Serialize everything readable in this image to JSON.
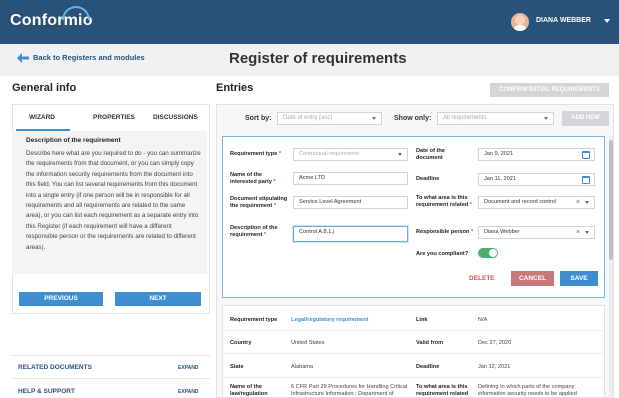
{
  "header": {
    "brand": "Conformio",
    "user_name": "DIANA WEBBER"
  },
  "subheader": {
    "back_link": "Back to Registers and modules",
    "page_title": "Register of requirements"
  },
  "left": {
    "section_title": "General info",
    "tabs": [
      "WIZARD",
      "PROPERTIES",
      "DISCUSSIONS"
    ],
    "active_tab": "WIZARD",
    "desc_title": "Description of the requirement",
    "desc_text": "Describe here what are you required to do - you can summarize the requirements from that document, or you can simply copy the information security requirements from the document into this field. You can list several requirements from this document into a single entry (if one person will be in responsible for all requirements and all requirements are related to the same area), or you can list each requirement as a separate entry into this Register (if each requirement will have a different responsible person or the requirements are related to different areas).",
    "prev_label": "PREVIOUS",
    "next_label": "NEXT",
    "related_docs": "RELATED DOCUMENTS",
    "help_support": "HELP & SUPPORT",
    "expand": "EXPAND"
  },
  "entries": {
    "section_title": "Entries",
    "confirm_label": "CONFIRM INITIAL REQUIREMENTS",
    "sort_by_label": "Sort by:",
    "sort_by_value": "Date of entry (asc)",
    "show_only_label": "Show only:",
    "show_only_value": "All requirements",
    "add_new": "ADD NEW"
  },
  "form": {
    "req_type_label": "Requirement type",
    "req_type_placeholder": "Contractual requirement",
    "party_label": "Name of the interested party",
    "party_value": "Acme LTD",
    "doc_label": "Document stipulating the requirement",
    "doc_value": "Service Level Agreement",
    "desc_label": "Description of the requirement",
    "desc_value": "Control A.8.1.|",
    "entry_date_label": "Date of the document",
    "entry_date_value": "Jan 9, 2021",
    "deadline_label": "Deadline",
    "deadline_value": "Jan 11, 2021",
    "area_label": "To what area is this requirement related",
    "area_value": "Document and record control",
    "resp_label": "Responsible person",
    "resp_value": "Diana Webber",
    "compliant_label": "Are you compliant?",
    "compliant": true,
    "delete": "DELETE",
    "cancel": "CANCEL",
    "save": "SAVE"
  },
  "record": {
    "type_label": "Requirement type",
    "type_value": "Legal/regulatory requirement",
    "link_label": "Link",
    "link_value": "N/A",
    "country_label": "Country",
    "country_value": "United States",
    "valid_label": "Valid from",
    "valid_value": "Dec 27, 2020",
    "state_label": "State",
    "state_value": "Alabama",
    "deadline_label": "Deadline",
    "deadline_value": "Jan 12, 2021",
    "law_label": "Name of the law/regulation",
    "law_value": "6 CFR Part 29 Procedures for Handling Critical Infrastructure Information ; Department of",
    "area_label": "To what area is this requirement related",
    "area_value": "Defining to which parts of the company information security needs to be applied"
  },
  "colors": {
    "header_bg": "#2a5279",
    "accent": "#3e8ed0",
    "cancel": "#c9787a",
    "delete": "#d9534f",
    "toggle_on": "#4caf72"
  }
}
